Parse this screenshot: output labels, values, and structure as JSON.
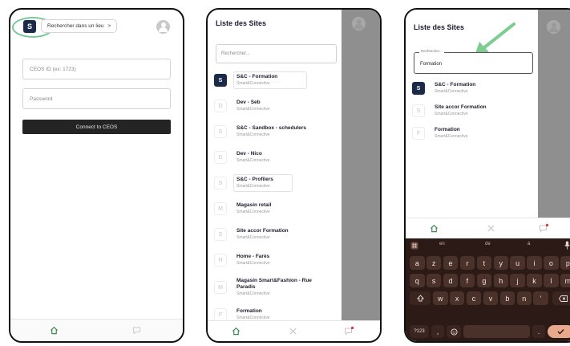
{
  "screen1": {
    "logo_letter": "S",
    "site_button": {
      "label": "Rechercher dans un lieu",
      "chevron": ">"
    },
    "ceos_field": {
      "placeholder": "CEOS ID (ex: 1723)"
    },
    "password_field": {
      "placeholder": "Password"
    },
    "connect_label": "Connect to CEOS",
    "nav": {
      "home_icon": "home-icon",
      "chat_icon": "chat-icon"
    }
  },
  "screen2": {
    "title": "Liste des Sites",
    "search_placeholder": "Rechercher...",
    "sites": [
      {
        "letter": "S",
        "name": "S&C - Formation",
        "org": "Smart&Connective",
        "active": true
      },
      {
        "letter": "D",
        "name": "Dev - Seb",
        "org": "Smart&Connective"
      },
      {
        "letter": "S",
        "name": "S&C - Sandbox - schedulers",
        "org": "Smart&Connective"
      },
      {
        "letter": "D",
        "name": "Dev - Nico",
        "org": "Smart&Connective"
      },
      {
        "letter": "S",
        "name": "S&C - Profilers",
        "org": "Smart&Connective"
      },
      {
        "letter": "M",
        "name": "Magasin retail",
        "org": "Smart&Connective"
      },
      {
        "letter": "S",
        "name": "Site accor Formation",
        "org": "Smart&Connective"
      },
      {
        "letter": "H",
        "name": "Home - Farès",
        "org": "Smart&Connective"
      },
      {
        "letter": "M",
        "name": "Magasin Smart&Fashion - Rue",
        "name2": "Paradis",
        "org": "Smart&Connective"
      },
      {
        "letter": "F",
        "name": "Formation",
        "org": "Smart&Connective"
      }
    ],
    "nav": {
      "home_icon": "home-icon",
      "tools_icon": "cross-tools-icon",
      "chat_icon": "chat-notification-icon"
    }
  },
  "screen3": {
    "title": "Liste des Sites",
    "search_label": "Rechercher...",
    "search_value": "Formation",
    "results": [
      {
        "letter": "S",
        "name": "S&C - Formation",
        "org": "Smart&Connective",
        "active": true
      },
      {
        "letter": "S",
        "name": "Site accor Formation",
        "org": "Smart&Connective"
      },
      {
        "letter": "F",
        "name": "Formation",
        "org": "Smart&Connective"
      }
    ],
    "keyboard": {
      "suggestions": [
        "en",
        "de",
        "à"
      ],
      "row1": [
        "a",
        "z",
        "e",
        "r",
        "t",
        "y",
        "u",
        "i",
        "o",
        "p"
      ],
      "row2": [
        "q",
        "s",
        "d",
        "f",
        "g",
        "h",
        "j",
        "k",
        "l",
        "m"
      ],
      "row3": [
        "w",
        "x",
        "c",
        "v",
        "b",
        "n",
        "'"
      ],
      "numbers_key": "?123",
      "comma_key": ",",
      "period_key": "."
    },
    "accent_color": "#7ccd8f"
  }
}
